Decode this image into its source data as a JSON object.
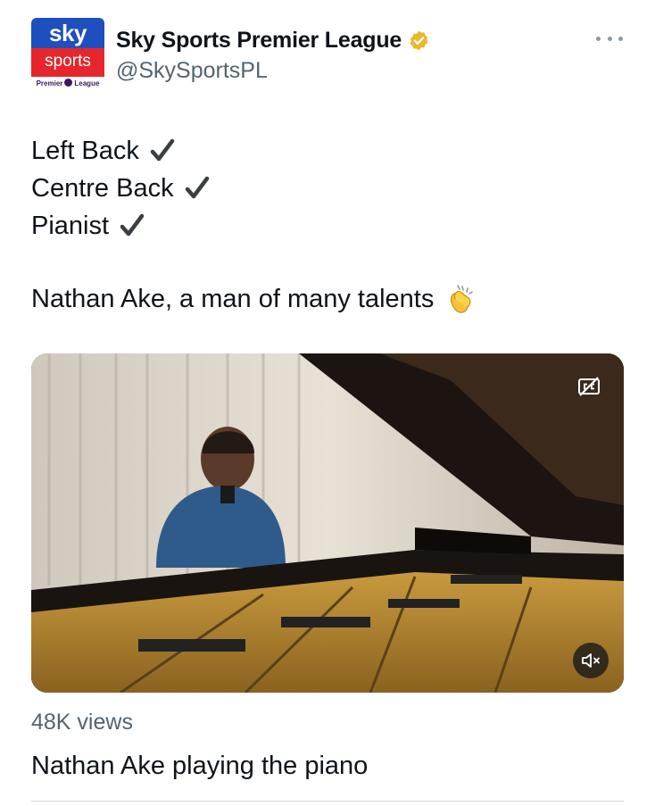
{
  "author": {
    "avatar_text": {
      "top": "sky",
      "middle": "sports",
      "bottom_left": "Premier",
      "bottom_right": "League"
    },
    "display_name": "Sky Sports Premier League",
    "handle": "@SkySportsPL",
    "verified_icon": "gold-verified-badge-icon"
  },
  "tweet": {
    "lines": [
      "Left Back",
      "Centre Back",
      "Pianist"
    ],
    "line_icon": "heavy-check-mark-icon",
    "sentence": "Nathan Ake, a man of many talents",
    "sentence_icon": "clapping-hands-icon"
  },
  "media": {
    "type": "video",
    "captions_icon": "closed-captions-icon",
    "mute_icon": "speaker-muted-icon",
    "views": "48K views",
    "caption": "Nathan Ake playing the piano"
  },
  "colors": {
    "text_primary": "#0f1419",
    "text_secondary": "#536471",
    "verified_gold": "#e8b82e",
    "sky_blue": "#1f4fbf",
    "sky_red": "#e5272d"
  }
}
